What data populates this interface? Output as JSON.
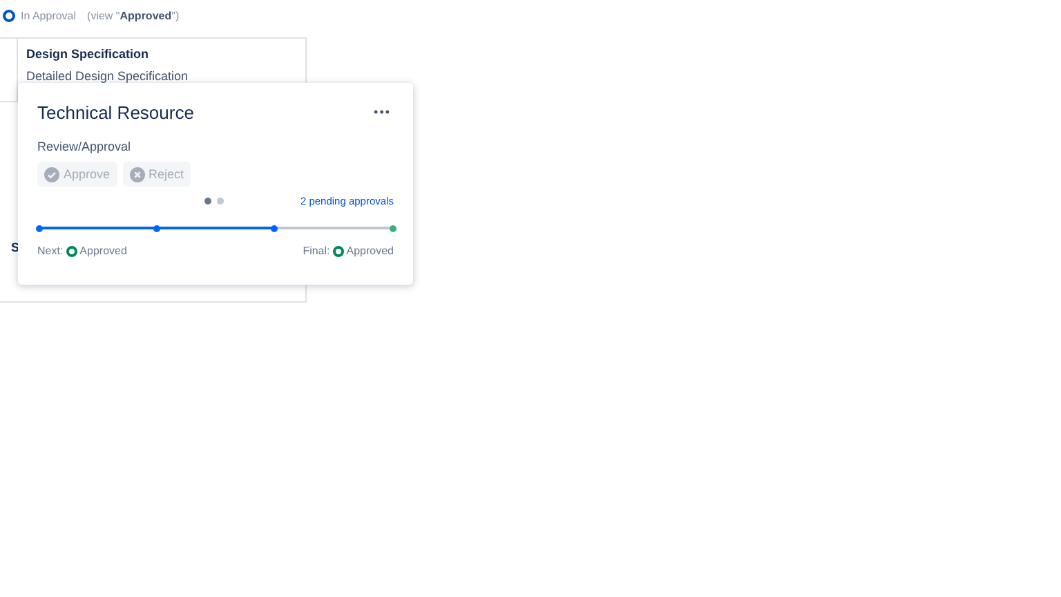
{
  "status": {
    "label": "In Approval",
    "view_prefix": "(view \"",
    "view_link": "Approved",
    "view_suffix": "\")"
  },
  "panel": {
    "heading": "Design Specification",
    "subtitle": "Detailed Design Specification",
    "side_letter": "S"
  },
  "popup": {
    "title": "Technical Resource",
    "menu": "•••",
    "section": "Review/Approval",
    "buttons": [
      {
        "label": "Approve",
        "kind": "approve",
        "disabled": true
      },
      {
        "label": "Reject",
        "kind": "reject",
        "disabled": true
      }
    ],
    "pages": [
      {
        "selected": true
      },
      {
        "selected": false
      }
    ],
    "pending": "2 pending approvals",
    "progress": {
      "level": 0.667,
      "steps": [
        {
          "done": true
        },
        {
          "done": true
        },
        {
          "done": true
        },
        {
          "done": false
        }
      ]
    },
    "next": {
      "label": "Next:",
      "state": "Approved"
    },
    "final": {
      "label": "Final:",
      "state": "Approved"
    }
  }
}
